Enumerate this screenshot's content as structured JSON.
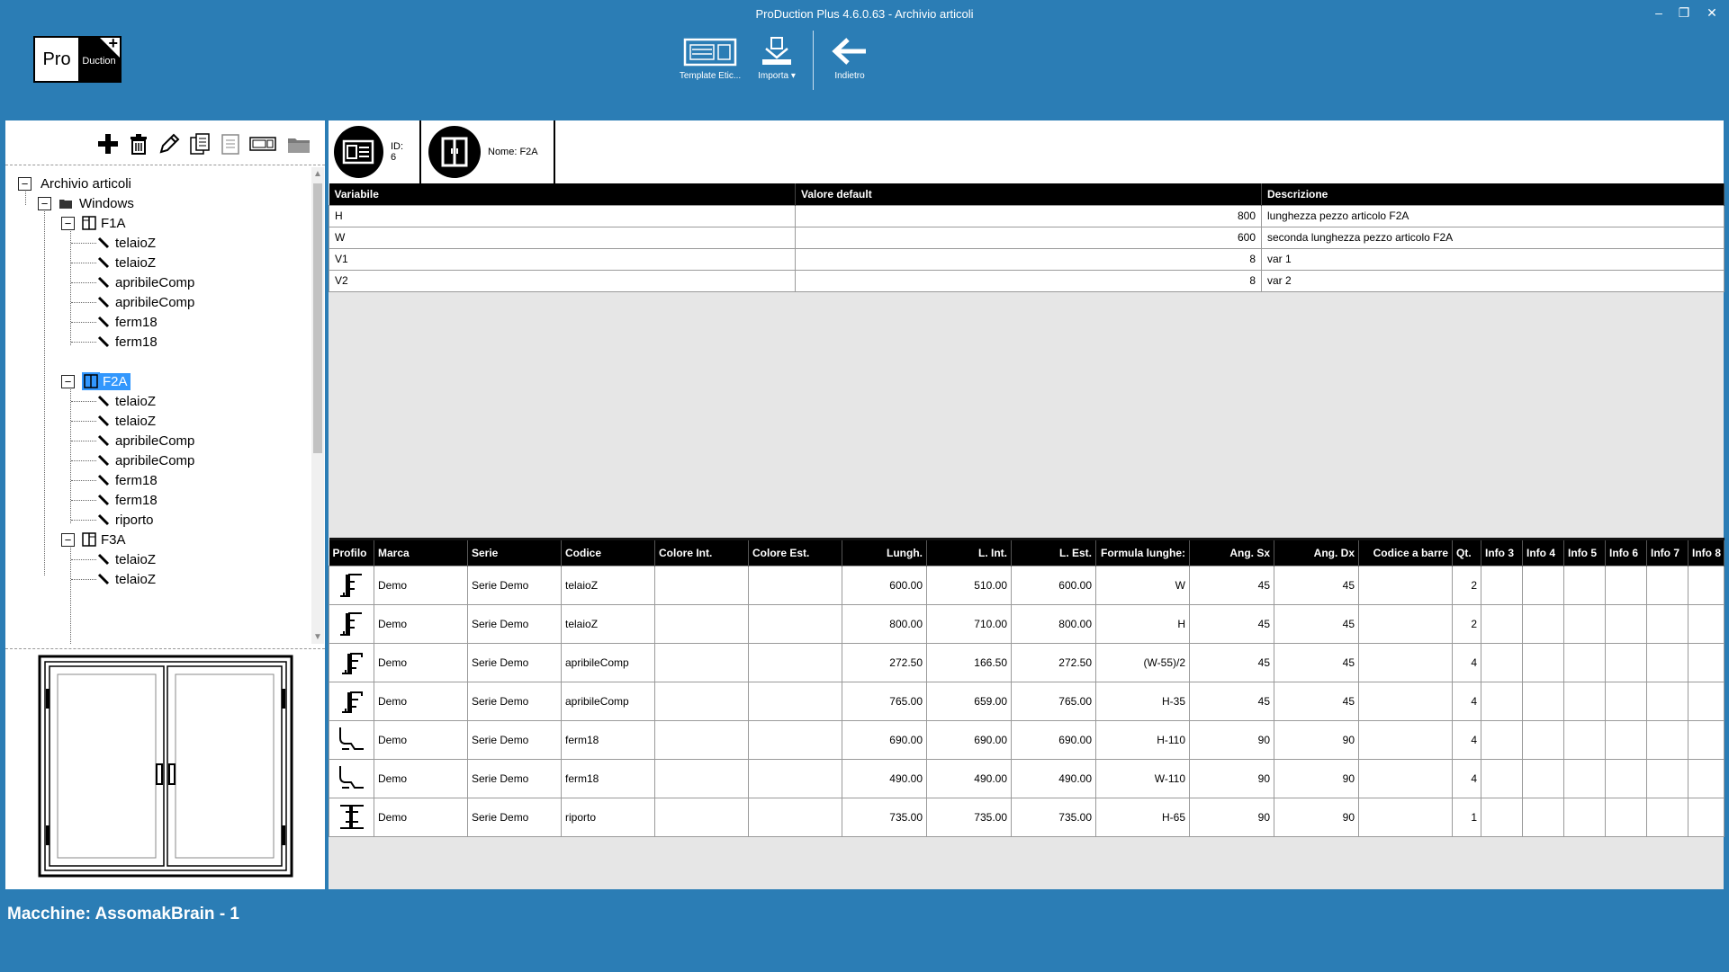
{
  "window": {
    "title": "ProDuction Plus 4.6.0.63 - Archivio articoli",
    "minimize": "–",
    "restore": "❐",
    "close": "✕"
  },
  "logo": {
    "left": "Pro",
    "right": "Duction",
    "plus": "+"
  },
  "toolbar": {
    "template_label": "Template Etic...",
    "import_label": "Importa",
    "back_label": "Indietro"
  },
  "tree": {
    "root": "Archivio articoli",
    "folder": "Windows",
    "items": [
      {
        "label": "F1A",
        "children": [
          "telaioZ",
          "telaioZ",
          "apribileComp",
          "apribileComp",
          "ferm18",
          "ferm18"
        ]
      },
      {
        "label": "F2A",
        "children": [
          "telaioZ",
          "telaioZ",
          "apribileComp",
          "apribileComp",
          "ferm18",
          "ferm18",
          "riporto"
        ]
      },
      {
        "label": "F3A",
        "children": [
          "telaioZ",
          "telaioZ"
        ]
      }
    ]
  },
  "header": {
    "id_text": "ID: 6",
    "name_text": "Nome: F2A"
  },
  "variables": {
    "columns": [
      "Variabile",
      "Valore default",
      "Descrizione"
    ],
    "rows": [
      [
        "H",
        "800",
        "lunghezza pezzo articolo F2A"
      ],
      [
        "W",
        "600",
        "seconda lunghezza pezzo articolo F2A"
      ],
      [
        "V1",
        "8",
        "var 1"
      ],
      [
        "V2",
        "8",
        "var 2"
      ]
    ]
  },
  "pieces": {
    "columns": [
      "Profilo",
      "Marca",
      "Serie",
      "Codice",
      "Colore Int.",
      "Colore Est.",
      "Lungh.",
      "L. Int.",
      "L. Est.",
      "Formula lunghe:",
      "Ang. Sx",
      "Ang. Dx",
      "Codice a barre",
      "Qt.",
      "Info 3",
      "Info 4",
      "Info 5",
      "Info 6",
      "Info 7",
      "Info 8"
    ],
    "rows": [
      {
        "profile": "z-profile-icon",
        "marca": "Demo",
        "serie": "Serie Demo",
        "codice": "telaioZ",
        "col_int": "",
        "col_est": "",
        "lungh": "600.00",
        "l_int": "510.00",
        "l_est": "600.00",
        "formula": "W",
        "ang_sx": "45",
        "ang_dx": "45",
        "barcode": "",
        "qt": "2"
      },
      {
        "profile": "z-profile-icon",
        "marca": "Demo",
        "serie": "Serie Demo",
        "codice": "telaioZ",
        "col_int": "",
        "col_est": "",
        "lungh": "800.00",
        "l_int": "710.00",
        "l_est": "800.00",
        "formula": "H",
        "ang_sx": "45",
        "ang_dx": "45",
        "barcode": "",
        "qt": "2"
      },
      {
        "profile": "sash-profile-icon",
        "marca": "Demo",
        "serie": "Serie Demo",
        "codice": "apribileComp",
        "col_int": "",
        "col_est": "",
        "lungh": "272.50",
        "l_int": "166.50",
        "l_est": "272.50",
        "formula": "(W-55)/2",
        "ang_sx": "45",
        "ang_dx": "45",
        "barcode": "",
        "qt": "4"
      },
      {
        "profile": "sash-profile-icon",
        "marca": "Demo",
        "serie": "Serie Demo",
        "codice": "apribileComp",
        "col_int": "",
        "col_est": "",
        "lungh": "765.00",
        "l_int": "659.00",
        "l_est": "765.00",
        "formula": "H-35",
        "ang_sx": "45",
        "ang_dx": "45",
        "barcode": "",
        "qt": "4"
      },
      {
        "profile": "bead-profile-icon",
        "marca": "Demo",
        "serie": "Serie Demo",
        "codice": "ferm18",
        "col_int": "",
        "col_est": "",
        "lungh": "690.00",
        "l_int": "690.00",
        "l_est": "690.00",
        "formula": "H-110",
        "ang_sx": "90",
        "ang_dx": "90",
        "barcode": "",
        "qt": "4"
      },
      {
        "profile": "bead-profile-icon",
        "marca": "Demo",
        "serie": "Serie Demo",
        "codice": "ferm18",
        "col_int": "",
        "col_est": "",
        "lungh": "490.00",
        "l_int": "490.00",
        "l_est": "490.00",
        "formula": "W-110",
        "ang_sx": "90",
        "ang_dx": "90",
        "barcode": "",
        "qt": "4"
      },
      {
        "profile": "t-profile-icon",
        "marca": "Demo",
        "serie": "Serie Demo",
        "codice": "riporto",
        "col_int": "",
        "col_est": "",
        "lungh": "735.00",
        "l_int": "735.00",
        "l_est": "735.00",
        "formula": "H-65",
        "ang_sx": "90",
        "ang_dx": "90",
        "barcode": "",
        "qt": "1"
      }
    ]
  },
  "status": {
    "machine_text": "Macchine:  AssomakBrain - 1"
  },
  "colors": {
    "chrome": "#2b7db5",
    "selection": "#3297fd",
    "header_black": "#000000"
  }
}
